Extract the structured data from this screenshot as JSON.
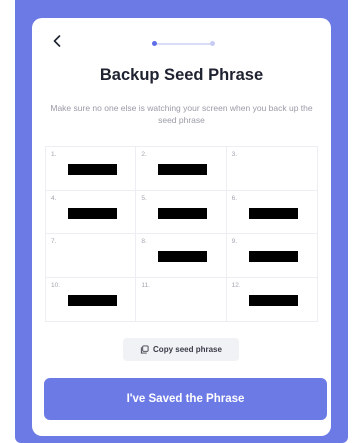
{
  "header": {
    "back_icon": "chevron-left-icon",
    "step_count": 2,
    "current_step": 1
  },
  "title": "Backup Seed Phrase",
  "subtitle": "Make sure no one else is watching your screen when you back up the seed phrase",
  "seed_words": [
    {
      "number": "1.",
      "redacted": true
    },
    {
      "number": "2.",
      "redacted": true
    },
    {
      "number": "3.",
      "redacted": false
    },
    {
      "number": "4.",
      "redacted": true
    },
    {
      "number": "5.",
      "redacted": true
    },
    {
      "number": "6.",
      "redacted": true
    },
    {
      "number": "7.",
      "redacted": false
    },
    {
      "number": "8.",
      "redacted": true
    },
    {
      "number": "9.",
      "redacted": true
    },
    {
      "number": "10.",
      "redacted": true
    },
    {
      "number": "11.",
      "redacted": false
    },
    {
      "number": "12.",
      "redacted": true
    }
  ],
  "copy_button": {
    "label": "Copy seed phrase",
    "icon": "copy-icon"
  },
  "primary_button": {
    "label": "I've Saved the Phrase"
  },
  "colors": {
    "accent": "#6c7ae6",
    "text_dark": "#1f2230",
    "text_muted": "#9a9ba6",
    "redaction": "#000000"
  }
}
